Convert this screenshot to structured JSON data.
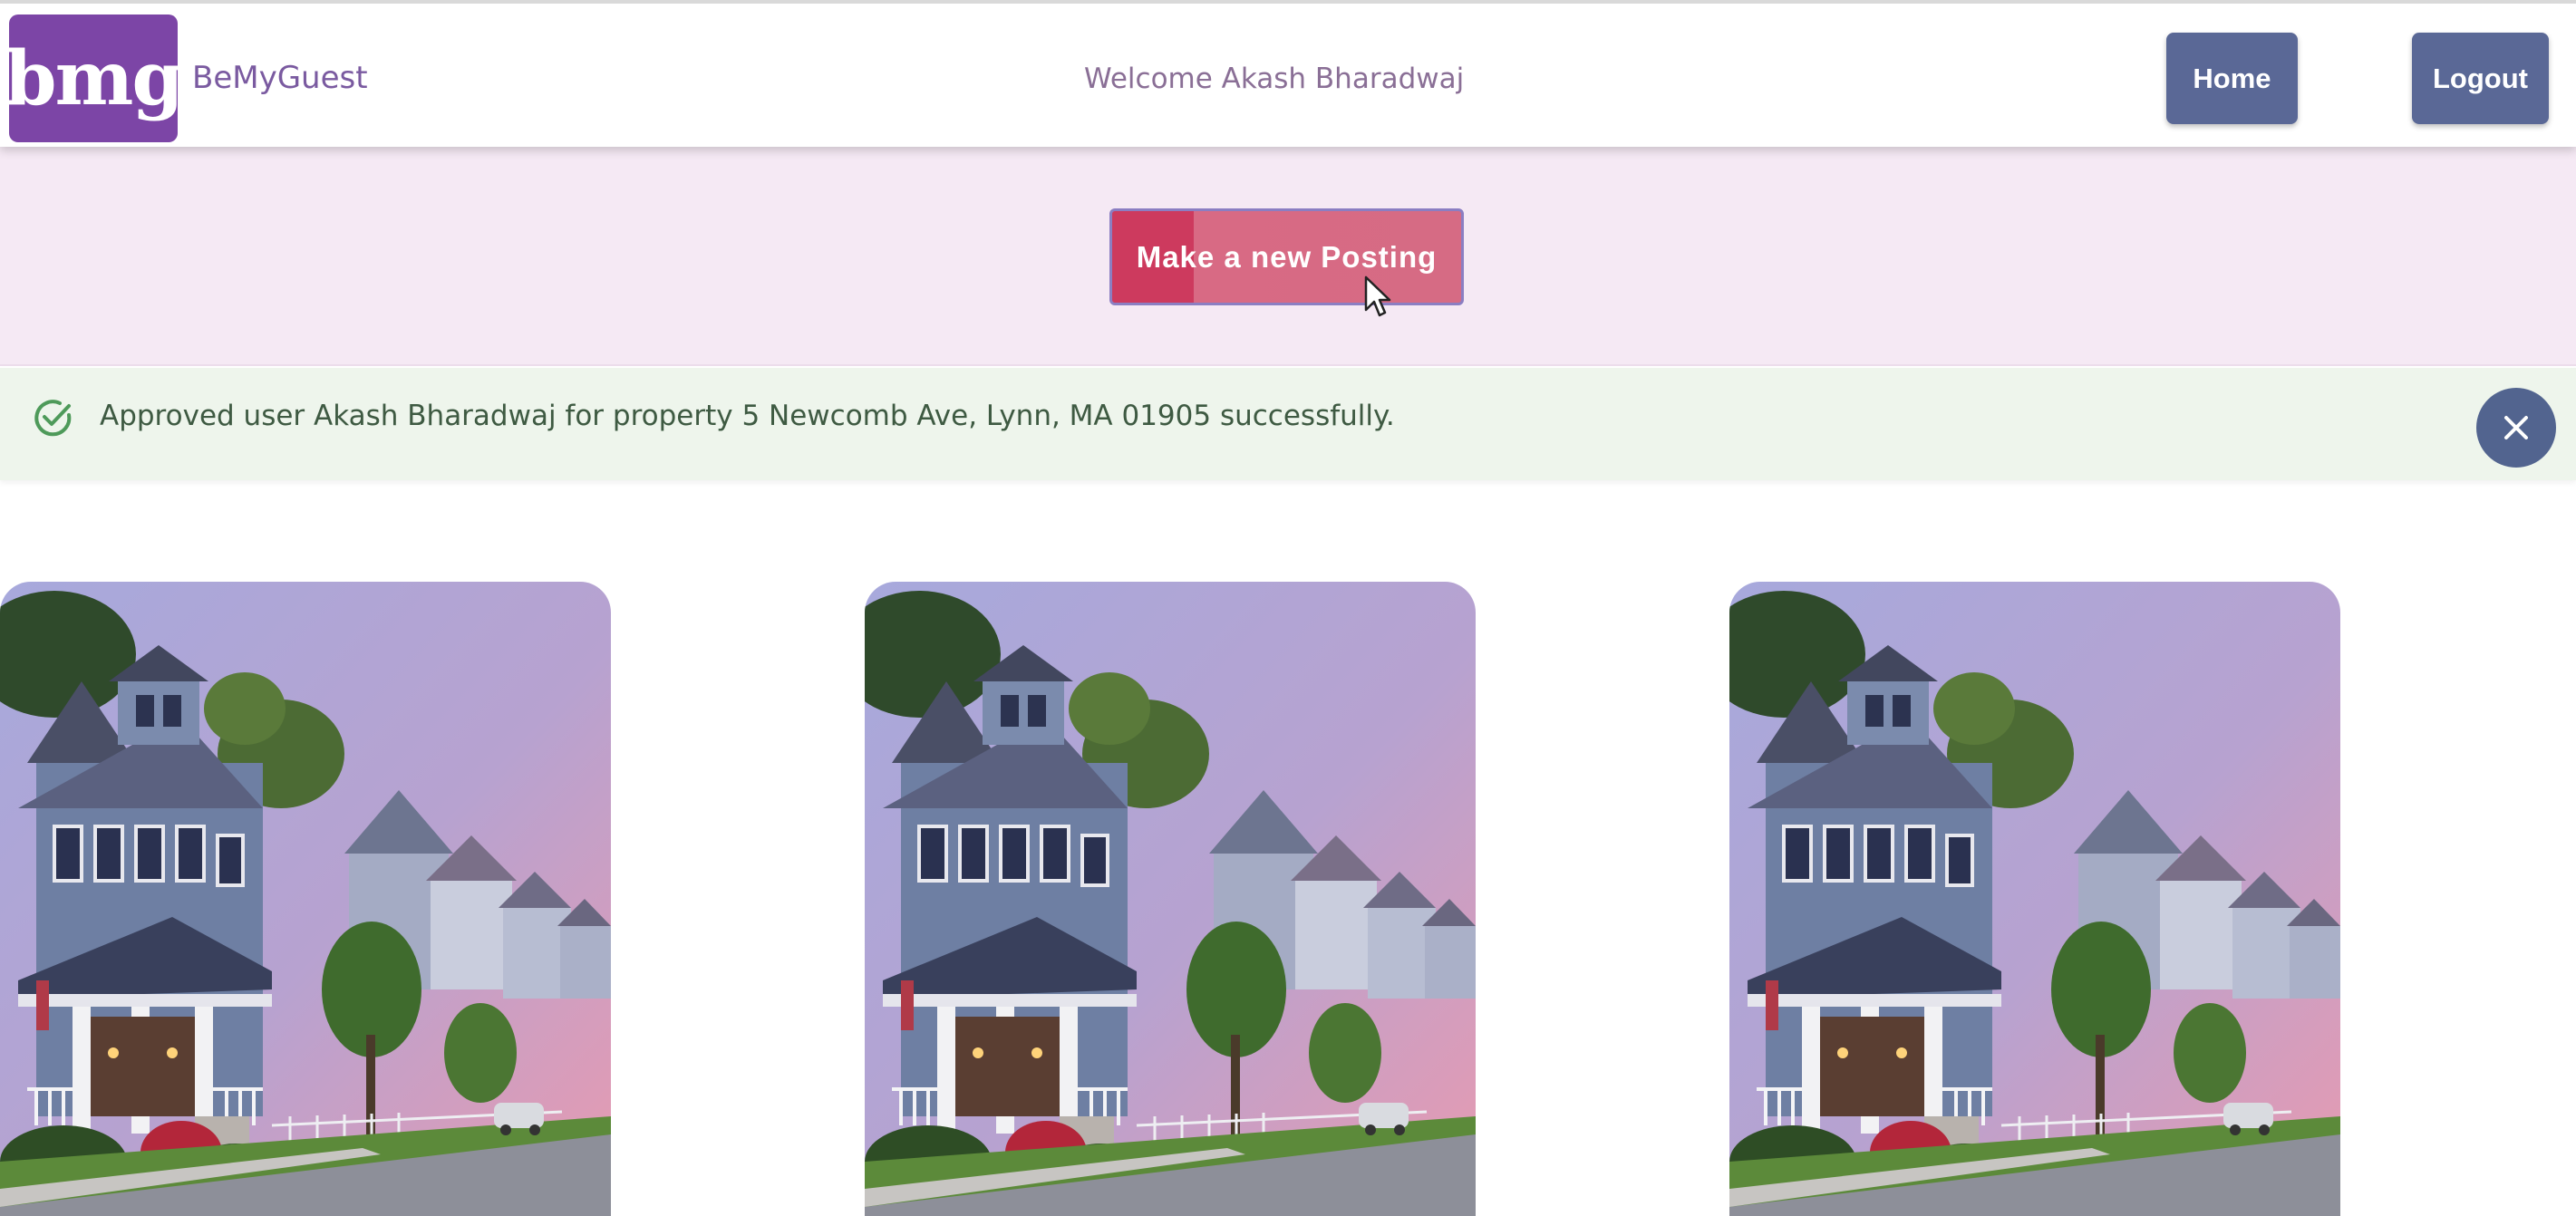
{
  "header": {
    "brand_name": "BeMyGuest",
    "logo_text": "bmg",
    "welcome_text": "Welcome Akash Bharadwaj",
    "home_label": "Home",
    "logout_label": "Logout"
  },
  "banner": {
    "new_posting_label": "Make a new Posting"
  },
  "alert": {
    "message": "Approved user Akash Bharadwaj for property 5 Newcomb Ave, Lynn, MA 01905 successfully.",
    "status": "success",
    "icon": "check-circle-icon",
    "close_icon": "close-icon"
  },
  "listings": [
    {
      "image": "house-photo"
    },
    {
      "image": "house-photo"
    },
    {
      "image": "house-photo"
    }
  ],
  "colors": {
    "brand": "#7c45a6",
    "nav_button": "#5a6896",
    "posting_button": "#cd3a5e",
    "banner_bg": "#f5e9f4",
    "alert_bg": "#eef5ec"
  }
}
